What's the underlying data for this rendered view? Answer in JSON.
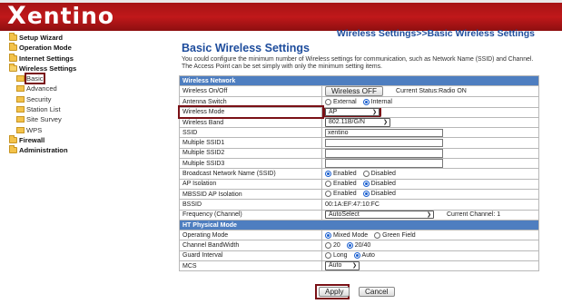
{
  "brand": {
    "logo_text": "entino",
    "logo_initial": "X"
  },
  "sidebar": {
    "items": [
      {
        "label": "Setup Wizard",
        "level": 0,
        "icon": "folder-icon"
      },
      {
        "label": "Operation Mode",
        "level": 0,
        "icon": "folder-icon"
      },
      {
        "label": "Internet Settings",
        "level": 0,
        "icon": "folder-icon"
      },
      {
        "label": "Wireless Settings",
        "level": 0,
        "icon": "folder-open-icon"
      },
      {
        "label": "Basic",
        "level": 1,
        "icon": "page-icon",
        "selected": true
      },
      {
        "label": "Advanced",
        "level": 1,
        "icon": "page-icon"
      },
      {
        "label": "Security",
        "level": 1,
        "icon": "page-icon"
      },
      {
        "label": "Station List",
        "level": 1,
        "icon": "page-icon"
      },
      {
        "label": "Site Survey",
        "level": 1,
        "icon": "page-icon"
      },
      {
        "label": "WPS",
        "level": 1,
        "icon": "page-icon"
      },
      {
        "label": "Firewall",
        "level": 0,
        "icon": "folder-icon"
      },
      {
        "label": "Administration",
        "level": 0,
        "icon": "folder-icon"
      }
    ]
  },
  "main": {
    "heading": "Wireless Settings>>Basic Wireless Settings",
    "title": "Basic Wireless Settings",
    "description": "You could configure the minimum number of Wireless settings for communication, such as Network Name (SSID) and Channel. The Access Point can be set simply with only the minimum setting items."
  },
  "wireless_network": {
    "section_label": "Wireless Network",
    "on_off_label": "Wireless On/Off",
    "on_off_button": "Wireless OFF",
    "current_status": "Current Status:Radio ON",
    "antenna_label": "Antenna Switch",
    "antenna_options": [
      "External",
      "Internal"
    ],
    "antenna_selected": "Internal",
    "mode_label": "Wireless Mode",
    "mode_value": "AP",
    "band_label": "Wireless Band",
    "band_value": "802.11B/G/N",
    "ssid_label": "SSID",
    "ssid_value": "xentino",
    "mssid1_label": "Multiple SSID1",
    "mssid1_value": "",
    "mssid2_label": "Multiple SSID2",
    "mssid2_value": "",
    "mssid3_label": "Multiple SSID3",
    "mssid3_value": "",
    "broadcast_label": "Broadcast Network Name (SSID)",
    "broadcast_options": [
      "Enabled",
      "Disabled"
    ],
    "broadcast_selected": "Enabled",
    "ap_isolation_label": "AP Isolation",
    "ap_isolation_options": [
      "Enabled",
      "Disabled"
    ],
    "ap_isolation_selected": "Disabled",
    "mbssid_label": "MBSSID AP Isolation",
    "mbssid_options": [
      "Enabled",
      "Disabled"
    ],
    "mbssid_selected": "Disabled",
    "bssid_label": "BSSID",
    "bssid_value": "00:1A:EF:47:10:FC",
    "channel_label": "Frequency (Channel)",
    "channel_value": "AutoSelect",
    "current_channel": "Current Channel: 1"
  },
  "ht_physical": {
    "section_label": "HT Physical Mode",
    "op_mode_label": "Operating Mode",
    "op_mode_options": [
      "Mixed Mode",
      "Green Field"
    ],
    "op_mode_selected": "Mixed Mode",
    "bandwidth_label": "Channel BandWidth",
    "bandwidth_options": [
      "20",
      "20/40"
    ],
    "bandwidth_selected": "20/40",
    "guard_label": "Guard Interval",
    "guard_options": [
      "Long",
      "Auto"
    ],
    "guard_selected": "Auto",
    "mcs_label": "MCS",
    "mcs_value": "Auto"
  },
  "actions": {
    "apply": "Apply",
    "cancel": "Cancel"
  },
  "colors": {
    "header_red": "#c0181a",
    "title_blue": "#1d4c9c",
    "section_blue": "#4e7ec0",
    "highlight": "#7a1016"
  }
}
